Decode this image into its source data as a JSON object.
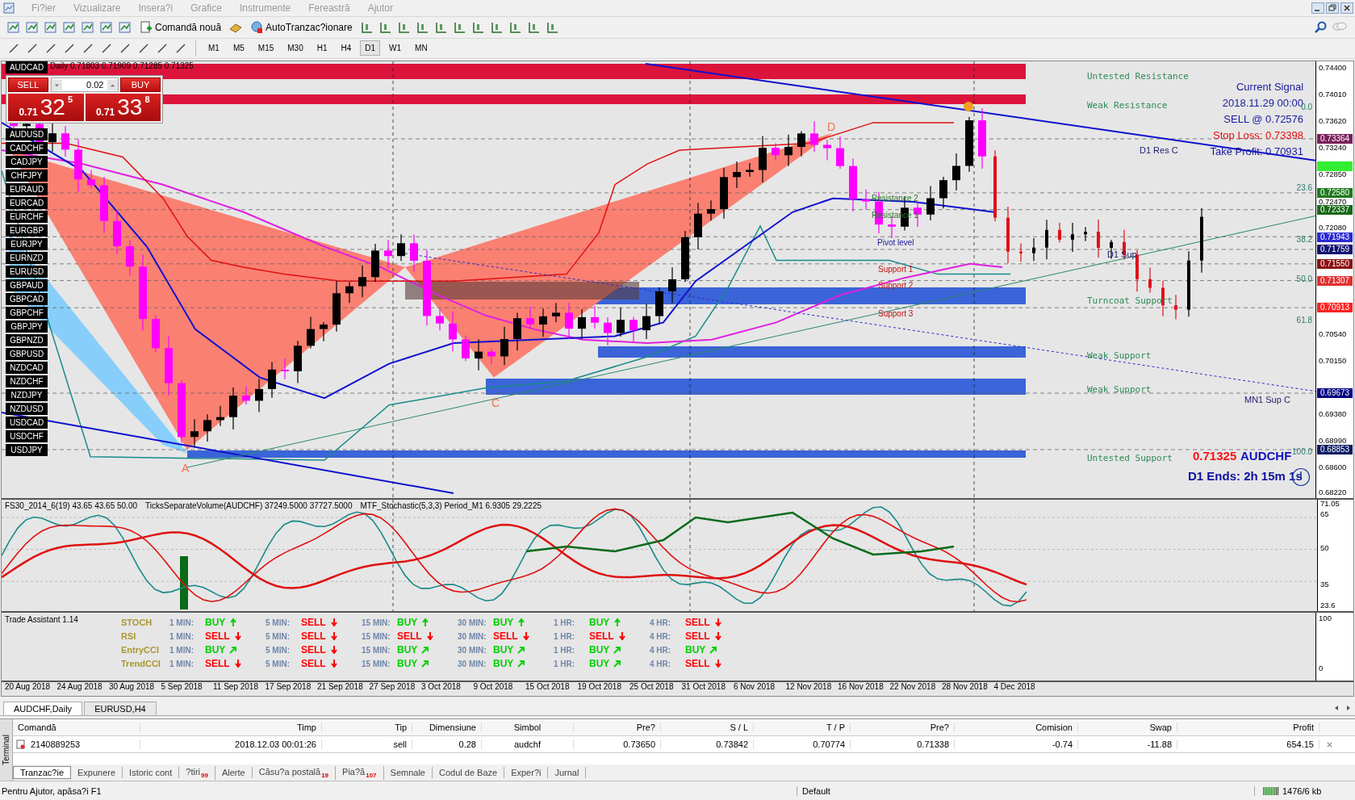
{
  "menu": [
    {
      "label": "Fi?ier"
    },
    {
      "label": "Vizualizare"
    },
    {
      "label": "Insera?i"
    },
    {
      "label": "Grafice"
    },
    {
      "label": "Instrumente"
    },
    {
      "label": "Fereastră"
    },
    {
      "label": "Ajutor"
    }
  ],
  "toolbar": {
    "new_order": "Comandă nouă",
    "auto_trading": "AutoTranzac?ionare"
  },
  "timeframes": [
    {
      "label": "M1",
      "selected": false
    },
    {
      "label": "M5",
      "selected": false
    },
    {
      "label": "M15",
      "selected": false
    },
    {
      "label": "M30",
      "selected": false
    },
    {
      "label": "H1",
      "selected": false
    },
    {
      "label": "H4",
      "selected": false
    },
    {
      "label": "D1",
      "selected": true
    },
    {
      "label": "W1",
      "selected": false
    },
    {
      "label": "MN",
      "selected": false
    }
  ],
  "chart": {
    "info": "Daily  0.71803 0.71909 0.71285 0.71325",
    "one_click": {
      "sell": "SELL",
      "buy": "BUY",
      "volume": "0.02",
      "sell_price": {
        "prefix": "0.71",
        "big": "32",
        "sup": "5"
      },
      "buy_price": {
        "prefix": "0.71",
        "big": "33",
        "sup": "8"
      }
    },
    "symbols": [
      "AUDCAD",
      "AUDUSD",
      "CADCHF",
      "CADJPY",
      "CHFJPY",
      "EURAUD",
      "EURCAD",
      "EURCHF",
      "EURGBP",
      "EURJPY",
      "EURNZD",
      "EURUSD",
      "GBPAUD",
      "GBPCAD",
      "GBPCHF",
      "GBPJPY",
      "GBPNZD",
      "GBPUSD",
      "NZDCAD",
      "NZDCHF",
      "NZDJPY",
      "NZDUSD",
      "USDCAD",
      "USDCHF",
      "USDJPY"
    ],
    "zones": [
      "Untested Resistance",
      "Weak Resistance",
      "Turncoat Support",
      "Weak Support",
      "Weak Support",
      "Untested Support"
    ],
    "signal": {
      "title": "Current Signal",
      "time": "2018.11.29 00:00",
      "entry": "SELL @ 0.72576",
      "stop_loss": "Stop Loss: 0.73398",
      "take_profit": "Take Profit: 0.70931"
    },
    "level_tags": [
      "D1 Res C",
      "D1 Sup",
      "MN1 Sup C"
    ],
    "fib_levels": [
      "0.0",
      "23.6",
      "38.2",
      "50.0",
      "61.8",
      "100.0"
    ],
    "pivots": [
      "Resistance 2",
      "Resistance 1",
      "Pivot level",
      "Support 1",
      "Support 2",
      "Support 3"
    ],
    "pattern_points": [
      "D",
      "C",
      "A"
    ],
    "footer": {
      "price": "0.71325",
      "symbol": "AUDCHF",
      "timer": "D1 Ends: 2h 15m 1s"
    },
    "price_axis": [
      "0.74400",
      "0.74010",
      "0.73620",
      "0.73240",
      "0.72850",
      "0.72470",
      "0.72080",
      "0.70540",
      "0.70150",
      "0.69380",
      "0.68990",
      "0.68600",
      "0.68220"
    ],
    "price_tags": [
      {
        "text": "0.73364",
        "color": "#7a1f5c"
      },
      {
        "text": "0.72580",
        "color": "#1f7a1f"
      },
      {
        "text": "0.72337",
        "color": "#186818"
      },
      {
        "text": "0.71943",
        "color": "#2a2ad0"
      },
      {
        "text": "0.71759",
        "color": "#101070"
      },
      {
        "text": "0.71550",
        "color": "#8b1010"
      },
      {
        "text": "0.71307",
        "color": "#e03030"
      },
      {
        "text": "0.70913",
        "color": "#ff2020"
      },
      {
        "text": "0.69673",
        "color": "#000080"
      },
      {
        "text": "0.68853",
        "color": "#0a1a60"
      }
    ]
  },
  "indicator": {
    "labels": [
      "FS30_2014_6(19) 43.65 43.65 50.00",
      "TicksSeparateVolume(AUDCHF) 37249.5000 37727.5000",
      "MTF_Stochastic(5,3,3) Period_M1 6.9305 29.2225"
    ],
    "axis": [
      "71.05",
      "65",
      "50",
      "35",
      "23.6"
    ]
  },
  "trade_assistant": {
    "title": "Trade Assistant 1.14",
    "axis": [
      "100",
      "0"
    ],
    "rows": [
      {
        "label": "STOCH",
        "cells": [
          {
            "tf": "1 MIN:",
            "signal": "BUY",
            "kind": "up"
          },
          {
            "tf": "5 MIN:",
            "signal": "SELL",
            "kind": "down"
          },
          {
            "tf": "15 MIN:",
            "signal": "BUY",
            "kind": "up"
          },
          {
            "tf": "30 MIN:",
            "signal": "BUY",
            "kind": "up"
          },
          {
            "tf": "1 HR:",
            "signal": "BUY",
            "kind": "up"
          },
          {
            "tf": "4 HR:",
            "signal": "SELL",
            "kind": "down"
          }
        ]
      },
      {
        "label": "RSI",
        "cells": [
          {
            "tf": "1 MIN:",
            "signal": "SELL",
            "kind": "down"
          },
          {
            "tf": "5 MIN:",
            "signal": "SELL",
            "kind": "down"
          },
          {
            "tf": "15 MIN:",
            "signal": "SELL",
            "kind": "down"
          },
          {
            "tf": "30 MIN:",
            "signal": "SELL",
            "kind": "down"
          },
          {
            "tf": "1 HR:",
            "signal": "SELL",
            "kind": "down"
          },
          {
            "tf": "4 HR:",
            "signal": "SELL",
            "kind": "down"
          }
        ]
      },
      {
        "label": "EntryCCI",
        "cells": [
          {
            "tf": "1 MIN:",
            "signal": "BUY",
            "kind": "rising"
          },
          {
            "tf": "5 MIN:",
            "signal": "SELL",
            "kind": "down"
          },
          {
            "tf": "15 MIN:",
            "signal": "BUY",
            "kind": "rising"
          },
          {
            "tf": "30 MIN:",
            "signal": "BUY",
            "kind": "rising"
          },
          {
            "tf": "1 HR:",
            "signal": "BUY",
            "kind": "rising"
          },
          {
            "tf": "4 HR:",
            "signal": "BUY",
            "kind": "rising"
          }
        ]
      },
      {
        "label": "TrendCCI",
        "cells": [
          {
            "tf": "1 MIN:",
            "signal": "SELL",
            "kind": "down"
          },
          {
            "tf": "5 MIN:",
            "signal": "SELL",
            "kind": "down"
          },
          {
            "tf": "15 MIN:",
            "signal": "BUY",
            "kind": "rising"
          },
          {
            "tf": "30 MIN:",
            "signal": "BUY",
            "kind": "rising"
          },
          {
            "tf": "1 HR:",
            "signal": "BUY",
            "kind": "rising"
          },
          {
            "tf": "4 HR:",
            "signal": "SELL",
            "kind": "down"
          }
        ]
      }
    ]
  },
  "dates": [
    "20 Aug 2018",
    "24 Aug 2018",
    "30 Aug 2018",
    "5 Sep 2018",
    "11 Sep 2018",
    "17 Sep 2018",
    "21 Sep 2018",
    "27 Sep 2018",
    "3 Oct 2018",
    "9 Oct 2018",
    "15 Oct 2018",
    "19 Oct 2018",
    "25 Oct 2018",
    "31 Oct 2018",
    "6 Nov 2018",
    "12 Nov 2018",
    "16 Nov 2018",
    "22 Nov 2018",
    "28 Nov 2018",
    "4 Dec 2018"
  ],
  "chart_tabs": [
    {
      "label": "AUDCHF,Daily",
      "selected": true
    },
    {
      "label": "EURUSD,H4",
      "selected": false
    }
  ],
  "terminal": {
    "side_label": "Terminal",
    "columns": [
      "Comandă",
      "Timp",
      "Tip",
      "Dimensiune",
      "Simbol",
      "Pre?",
      "S / L",
      "T / P",
      "Pre?",
      "Comision",
      "Swap",
      "Profit"
    ],
    "rows": [
      [
        "2140889253",
        "2018.12.03 00:01:26",
        "sell",
        "0.28",
        "audchf",
        "0.73650",
        "0.73842",
        "0.70774",
        "0.71338",
        "-0.74",
        "-11.88",
        "654.15"
      ]
    ],
    "tabs": [
      {
        "label": "Tranzac?ie",
        "selected": true
      },
      {
        "label": "Expunere",
        "selected": false
      },
      {
        "label": "Istoric cont",
        "selected": false
      },
      {
        "label": "?tiri",
        "badge": "99",
        "selected": false
      },
      {
        "label": "Alerte",
        "selected": false
      },
      {
        "label": "Căsu?a postală",
        "badge": "19",
        "selected": false
      },
      {
        "label": "Pia?ă",
        "badge": "107",
        "selected": false
      },
      {
        "label": "Semnale",
        "selected": false
      },
      {
        "label": "Codul de Baze",
        "selected": false
      },
      {
        "label": "Exper?i",
        "selected": false
      },
      {
        "label": "Jurnal",
        "selected": false
      }
    ]
  },
  "status_bar": {
    "help": "Pentru Ajutor, apăsa?i F1",
    "profile": "Default",
    "traffic": "1476/6 kb"
  }
}
